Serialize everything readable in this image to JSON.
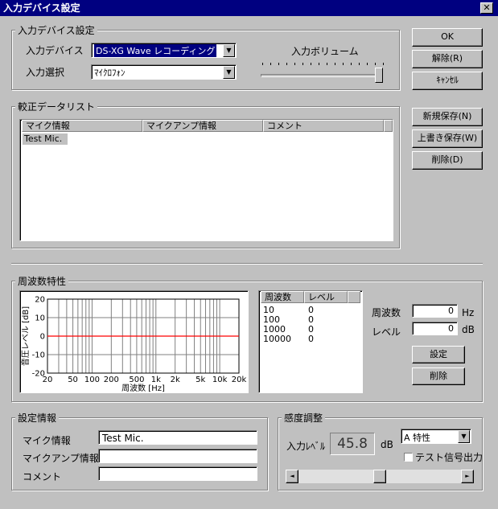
{
  "window": {
    "title": "入力デバイス設定",
    "close_glyph": "✕"
  },
  "device": {
    "legend": "入力デバイス設定",
    "device_label": "入力デバイス",
    "device_value": "DS-XG Wave レコーディング",
    "select_label": "入力選択",
    "select_value": "ﾏｲｸﾛﾌｫﾝ",
    "volume_label": "入力ボリューム",
    "volume_level": 1.0
  },
  "buttons": {
    "ok": "OK",
    "release": "解除(R)",
    "cancel": "ｷｬﾝｾﾙ",
    "new_save": "新規保存(N)",
    "overwrite": "上書き保存(W)",
    "delete": "削除(D)"
  },
  "calib": {
    "legend": "較正データリスト",
    "columns": [
      "マイク情報",
      "マイクアンプ情報",
      "コメント"
    ],
    "rows": [
      {
        "mic": "Test Mic.",
        "amp": "",
        "comment": ""
      }
    ]
  },
  "freq": {
    "legend": "周波数特性",
    "table_columns": [
      "周波数",
      "レベル"
    ],
    "table_rows": [
      {
        "f": "10",
        "l": "0"
      },
      {
        "f": "100",
        "l": "0"
      },
      {
        "f": "1000",
        "l": "0"
      },
      {
        "f": "10000",
        "l": "0"
      }
    ],
    "freq_label": "周波数",
    "freq_value": "0",
    "freq_unit": "Hz",
    "level_label": "レベル",
    "level_value": "0",
    "level_unit": "dB",
    "set_button": "設定",
    "delete_button": "削除"
  },
  "chart_data": {
    "type": "line",
    "xlabel": "周波数 [Hz]",
    "ylabel": "音圧レベル [dB]",
    "x_scale": "log",
    "xlim": [
      20,
      20000
    ],
    "ylim": [
      -20,
      20
    ],
    "x_ticks": [
      {
        "v": 20,
        "label": "20"
      },
      {
        "v": 50,
        "label": "50"
      },
      {
        "v": 100,
        "label": "100"
      },
      {
        "v": 200,
        "label": "200"
      },
      {
        "v": 500,
        "label": "500"
      },
      {
        "v": 1000,
        "label": "1k"
      },
      {
        "v": 2000,
        "label": "2k"
      },
      {
        "v": 5000,
        "label": "5k"
      },
      {
        "v": 10000,
        "label": "10k"
      },
      {
        "v": 20000,
        "label": "20k"
      }
    ],
    "y_ticks": [
      20,
      10,
      0,
      -10,
      -20
    ],
    "grid": true,
    "series": [
      {
        "color": "#ff0000",
        "x": [
          20,
          20000
        ],
        "y": [
          0,
          0
        ]
      }
    ]
  },
  "settings": {
    "legend": "設定情報",
    "mic_label": "マイク情報",
    "mic_value": "Test Mic.",
    "amp_label": "マイクアンプ情報",
    "amp_value": "",
    "comment_label": "コメント",
    "comment_value": ""
  },
  "sensitivity": {
    "legend": "感度調整",
    "level_label": "入力ﾚﾍﾞﾙ",
    "level_value": "45.8",
    "level_unit": "dB",
    "weighting": "A 特性",
    "test_signal_label": "テスト信号出力",
    "test_signal_checked": false,
    "slider_level": 0.5,
    "left_arrow": "◄",
    "right_arrow": "►"
  }
}
